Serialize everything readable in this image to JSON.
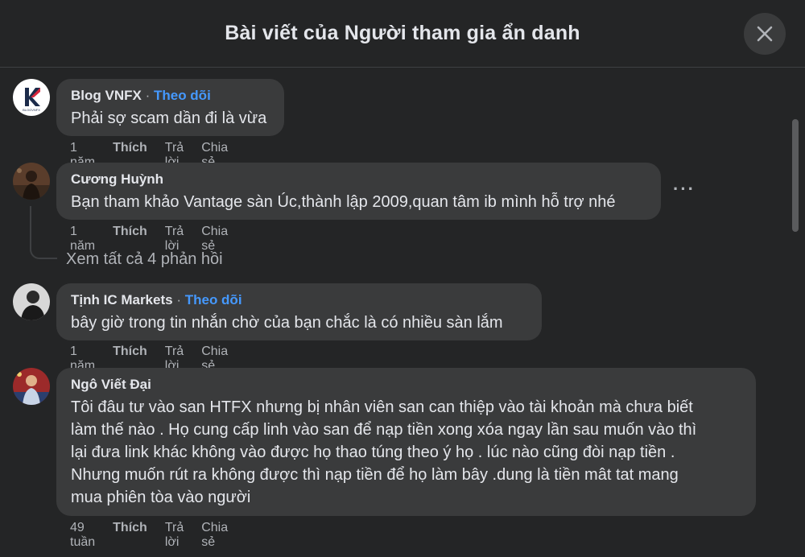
{
  "header": {
    "title": "Bài viết của Người tham gia ẩn danh"
  },
  "comments": [
    {
      "author": "Blog VNFX",
      "follow": "Theo dõi",
      "text": "Phải sợ scam dần đi là vừa",
      "time": "1 năm",
      "like": "Thích",
      "reply": "Trả lời",
      "share": "Chia sẻ",
      "avatar_label": "BLOGVNFX"
    },
    {
      "author": "Cương Huỳnh",
      "text": "Bạn tham khảo Vantage sàn Úc,thành lập 2009,quan tâm ib mình hỗ trợ nhé",
      "time": "1 năm",
      "like": "Thích",
      "reply": "Trả lời",
      "share": "Chia sẻ",
      "more": "···"
    },
    {
      "author": "Tịnh IC Markets",
      "follow": "Theo dõi",
      "text": "bây giờ trong tin nhắn chờ của bạn chắc là có nhiều sàn lắm",
      "time": "1 năm",
      "like": "Thích",
      "reply": "Trả lời",
      "share": "Chia sẻ"
    },
    {
      "author": "Ngô Viết Đại",
      "text_lines": [
        "Tôi đâu tư vào san HTFX nhưng bị nhân viên san can thiệp vào tài khoản mà chưa biết",
        "làm thế nào . Họ cung cấp linh vào san để nạp tiền xong xóa ngay lần sau muốn vào thì",
        "lại đưa link khác không vào được họ thao túng theo ý họ . lúc nào cũng đòi nạp tiền .",
        "Nhưng muốn rút ra không được thì nạp tiền để họ làm bây .dung là tiền mât tat mang",
        "mua phiên tòa vào người"
      ],
      "time": "49 tuần",
      "like": "Thích",
      "reply": "Trả lời",
      "share": "Chia sẻ"
    }
  ],
  "view_replies": "Xem tất cả 4 phản hồi",
  "colors": {
    "background": "#242526",
    "bubble": "#3a3b3c",
    "link": "#4599ff",
    "muted": "#b0b3b8"
  },
  "icons": {
    "close": "close-icon",
    "more": "more-horizontal-icon"
  }
}
